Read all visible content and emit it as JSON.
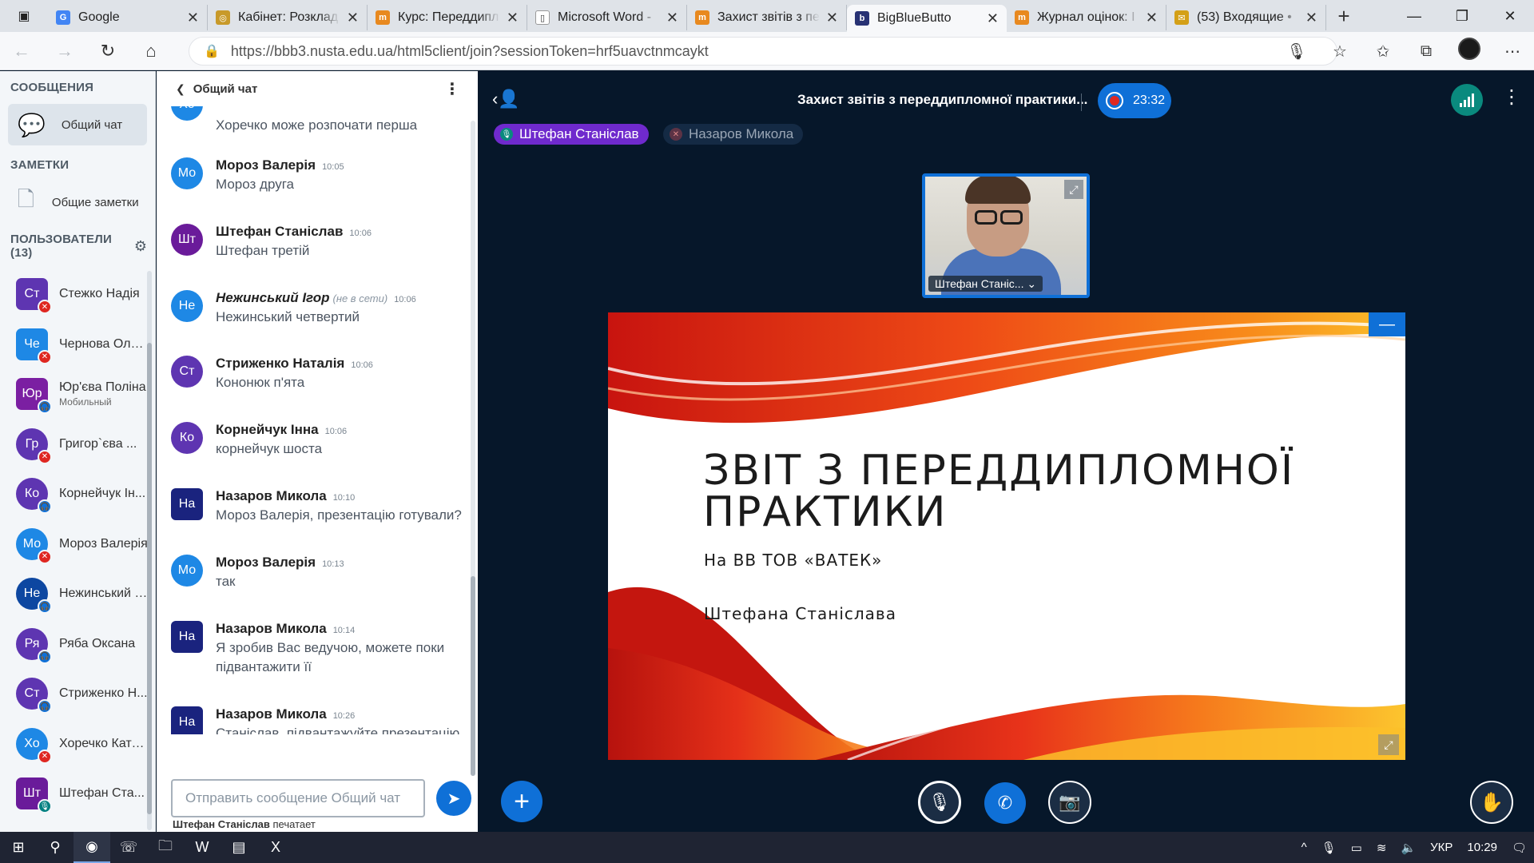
{
  "browser": {
    "tabs": [
      {
        "label": "Google",
        "favicon": "google",
        "color": "#4285f4",
        "glyph": "G"
      },
      {
        "label": "Кабінет: Розклад",
        "favicon": "cabinet",
        "color": "#c89a2a",
        "glyph": "◎"
      },
      {
        "label": "Курс: Переддипл",
        "favicon": "moodle",
        "color": "#e8891f",
        "glyph": "m"
      },
      {
        "label": "Microsoft Word -",
        "favicon": "document",
        "color": "#ffffff",
        "glyph": "▯"
      },
      {
        "label": "Захист звітів з пе",
        "favicon": "moodle",
        "color": "#e8891f",
        "glyph": "m"
      },
      {
        "label": "BigBlueButto",
        "favicon": "bigbluebutton",
        "color": "#283274",
        "glyph": "b",
        "active": true
      },
      {
        "label": "Журнал оцінок: I",
        "favicon": "moodle",
        "color": "#e8891f",
        "glyph": "m"
      },
      {
        "label": "(53) Входящие •",
        "favicon": "mail",
        "color": "#d4a017",
        "glyph": "✉"
      }
    ],
    "url_host": "https://bbb3.nusta.edu.ua",
    "url_path": "/html5client/join?sessionToken=hrf5uavctnmcaykt"
  },
  "sidebar": {
    "messages_title": "СООБЩЕНИЯ",
    "public_chat": "Общий чат",
    "notes_title": "ЗАМЕТКИ",
    "shared_notes": "Общие заметки",
    "users_title": "ПОЛЬЗОВАТЕЛИ (13)",
    "users": [
      {
        "initials": "Ст",
        "name": "Стежко Надія",
        "color": "#5e35b1",
        "status": "muted",
        "shape": "square"
      },
      {
        "initials": "Че",
        "name": "Чернова Оль...",
        "color": "#1e88e5",
        "status": "muted",
        "shape": "square"
      },
      {
        "initials": "Юр",
        "name": "Юр'єва Поліна",
        "sub": "Мобильный",
        "color": "#7b1fa2",
        "status": "listen",
        "shape": "square"
      },
      {
        "initials": "Гр",
        "name": "Григор`єва ...",
        "color": "#5e35b1",
        "status": "muted",
        "shape": "round"
      },
      {
        "initials": "Ко",
        "name": "Корнейчук Ін...",
        "color": "#5e35b1",
        "status": "listen",
        "shape": "round"
      },
      {
        "initials": "Мо",
        "name": "Мороз Валерія",
        "color": "#1e88e5",
        "status": "muted",
        "shape": "round"
      },
      {
        "initials": "Не",
        "name": "Нежинський І...",
        "color": "#0d47a1",
        "status": "listen",
        "shape": "round"
      },
      {
        "initials": "Ря",
        "name": "Ряба Оксана",
        "color": "#5e35b1",
        "status": "listen",
        "shape": "round"
      },
      {
        "initials": "Ст",
        "name": "Стриженко Н...",
        "color": "#5e35b1",
        "status": "listen",
        "shape": "round"
      },
      {
        "initials": "Хо",
        "name": "Хоречко Кате...",
        "color": "#1e88e5",
        "status": "muted",
        "shape": "round"
      },
      {
        "initials": "Шт",
        "name": "Штефан Ста...",
        "color": "#6a1b9a",
        "status": "voice",
        "shape": "square"
      }
    ]
  },
  "chat": {
    "header": "Общий чат",
    "messages": [
      {
        "initials": "Хо",
        "color": "#1e88e5",
        "shape": "round",
        "name": "",
        "time": "",
        "text": "Хоречко може розпочати перша",
        "cut": true
      },
      {
        "initials": "Мо",
        "color": "#1e88e5",
        "shape": "round",
        "name": "Мороз Валерія",
        "time": "10:05",
        "text": "Мороз друга"
      },
      {
        "initials": "Шт",
        "color": "#6a1b9a",
        "shape": "round",
        "name": "Штефан Станіслав",
        "time": "10:06",
        "text": "Штефан третій"
      },
      {
        "initials": "Не",
        "color": "#1e88e5",
        "shape": "round",
        "name": "Нежинський Ігор",
        "offline": "(не в сети)",
        "time": "10:06",
        "text": "Нежинський четвертий"
      },
      {
        "initials": "Ст",
        "color": "#5e35b1",
        "shape": "round",
        "name": "Стриженко Наталія",
        "time": "10:06",
        "text": "Кононюк п'ята"
      },
      {
        "initials": "Ко",
        "color": "#5e35b1",
        "shape": "round",
        "name": "Корнейчук Інна",
        "time": "10:06",
        "text": "корнейчук шоста"
      },
      {
        "initials": "На",
        "color": "#1a237e",
        "shape": "square",
        "name": "Назаров Микола",
        "time": "10:10",
        "text": "Мороз Валерія, презентацію готували?"
      },
      {
        "initials": "Мо",
        "color": "#1e88e5",
        "shape": "round",
        "name": "Мороз Валерія",
        "time": "10:13",
        "text": "так"
      },
      {
        "initials": "На",
        "color": "#1a237e",
        "shape": "square",
        "name": "Назаров Микола",
        "time": "10:14",
        "text": "Я зробив Вас ведучою, можете поки підвантажити її",
        "tall": true
      },
      {
        "initials": "На",
        "color": "#1a237e",
        "shape": "square",
        "name": "Назаров Микола",
        "time": "10:26",
        "text": "Станіслав, підвантажуйте презентацію"
      }
    ],
    "input_placeholder": "Отправить сообщение Общий чат",
    "typing_user": "Штефан Станіслав",
    "typing_suffix": "печатает"
  },
  "meeting": {
    "title": "Захист звітів з переддипломної практики...",
    "recording_time": "23:32",
    "talkers": [
      {
        "name": "Штефан Станіслав",
        "active": true
      },
      {
        "name": "Назаров Микола",
        "active": false
      }
    ],
    "webcam_label": "Штефан Станіс... ⌄"
  },
  "slide": {
    "title_line1": "ЗВІТ З ПЕРЕДДИПЛОМНОЇ",
    "title_line2": "ПРАКТИКИ",
    "subtitle": "На ВВ ТОВ «ВАТЕК»",
    "author": "Штефана Станіслава"
  },
  "taskbar": {
    "lang": "УКР",
    "time": "10:29"
  },
  "colors": {
    "accent": "#0f70d7",
    "background_dark": "#06172a",
    "muted": "#df2721",
    "talker_active": "#6f2acd"
  }
}
